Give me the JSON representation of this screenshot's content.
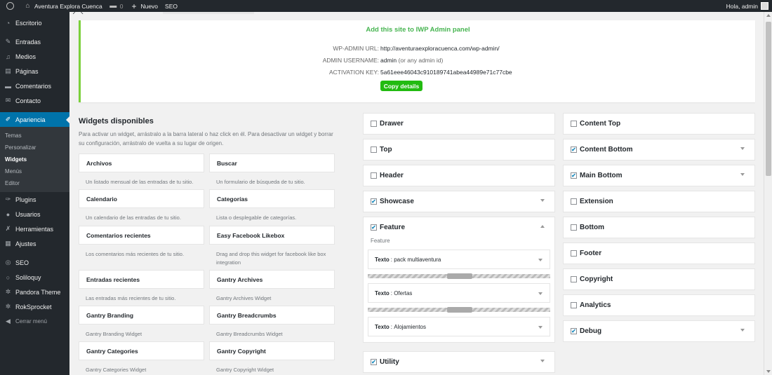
{
  "adminbar": {
    "site_name": "Aventura Explora Cuenca",
    "comments_count": "0",
    "new_label": "Nuevo",
    "seo_label": "SEO",
    "greeting": "Hola, admin"
  },
  "sidebar": {
    "items": [
      {
        "label": "Escritorio",
        "icon": "dashboard-icon"
      },
      {
        "label": "Entradas",
        "icon": "pin-icon"
      },
      {
        "label": "Medios",
        "icon": "media-icon"
      },
      {
        "label": "Páginas",
        "icon": "pages-icon"
      },
      {
        "label": "Comentarios",
        "icon": "comment-icon"
      },
      {
        "label": "Contacto",
        "icon": "mail-icon"
      },
      {
        "label": "Apariencia",
        "icon": "brush-icon"
      },
      {
        "label": "Plugins",
        "icon": "plugin-icon"
      },
      {
        "label": "Usuarios",
        "icon": "users-icon"
      },
      {
        "label": "Herramientas",
        "icon": "wrench-icon"
      },
      {
        "label": "Ajustes",
        "icon": "settings-icon"
      },
      {
        "label": "SEO",
        "icon": "seo-icon"
      },
      {
        "label": "Soliloquy",
        "icon": "soliloquy-icon"
      },
      {
        "label": "Pandora Theme",
        "icon": "gear-icon"
      },
      {
        "label": "RokSprocket",
        "icon": "rocket-icon"
      },
      {
        "label": "Cerrar menú",
        "icon": "collapse-icon"
      }
    ],
    "submenu": [
      "Temas",
      "Personalizar",
      "Widgets",
      "Menús",
      "Editor"
    ]
  },
  "iwp": {
    "title": "Add this site to IWP Admin panel",
    "url_label": "WP-ADMIN URL:",
    "url_value": "http://aventuraexploracuenca.com/wp-admin/",
    "user_label": "ADMIN USERNAME:",
    "user_value": "admin",
    "user_hint": "(or any admin id)",
    "key_label": "ACTIVATION KEY:",
    "key_value": "5a61eee46043c910189741abea44989e71c77cbe",
    "copy_button": "Copy details"
  },
  "available": {
    "title": "Widgets disponibles",
    "description": "Para activar un widget, arrástralo a la barra lateral o haz click en él. Para desactivar un widget y borrar su configuración, arrástralo de vuelta a su lugar de origen.",
    "widgets": [
      {
        "name": "Archivos",
        "desc": "Un listado mensual de las entradas de tu sitio."
      },
      {
        "name": "Buscar",
        "desc": "Un formulario de búsqueda de tu sitio."
      },
      {
        "name": "Calendario",
        "desc": "Un calendario de las entradas de tu sitio."
      },
      {
        "name": "Categorías",
        "desc": "Lista o desplegable de categorías."
      },
      {
        "name": "Comentarios recientes",
        "desc": "Los comentarios más recientes de tu sitio."
      },
      {
        "name": "Easy Facebook Likebox",
        "desc": "Drag and drop this widget for facebook like box integration"
      },
      {
        "name": "Entradas recientes",
        "desc": "Las entradas más recientes de tu sitio."
      },
      {
        "name": "Gantry Archives",
        "desc": "Gantry Archives Widget"
      },
      {
        "name": "Gantry Branding",
        "desc": "Gantry Branding Widget"
      },
      {
        "name": "Gantry Breadcrumbs",
        "desc": "Gantry Breadcrumbs Widget"
      },
      {
        "name": "Gantry Categories",
        "desc": "Gantry Categories Widget"
      },
      {
        "name": "Gantry Copyright",
        "desc": "Gantry Copyright Widget"
      }
    ]
  },
  "sidebars_left": {
    "drawer": "Drawer",
    "top": "Top",
    "header": "Header",
    "showcase": "Showcase",
    "feature": "Feature",
    "feature_desc": "Feature",
    "feature_widgets": [
      {
        "type": "Texto",
        "title": "pack multiaventura"
      },
      {
        "type": "Texto",
        "title": "Ofertas"
      },
      {
        "type": "Texto",
        "title": "Alojamientos"
      }
    ],
    "utility": "Utility"
  },
  "sidebars_right": {
    "content_top": "Content Top",
    "content_bottom": "Content Bottom",
    "main_bottom": "Main Bottom",
    "extension": "Extension",
    "bottom": "Bottom",
    "footer": "Footer",
    "copyright": "Copyright",
    "analytics": "Analytics",
    "debug": "Debug"
  },
  "checkmark": "✔",
  "colors": {
    "adminbar_bg": "#23282d",
    "menu_current": "#0073aa",
    "iwp_border": "#7ad03a",
    "copy_button_bg": "#22bb11"
  }
}
